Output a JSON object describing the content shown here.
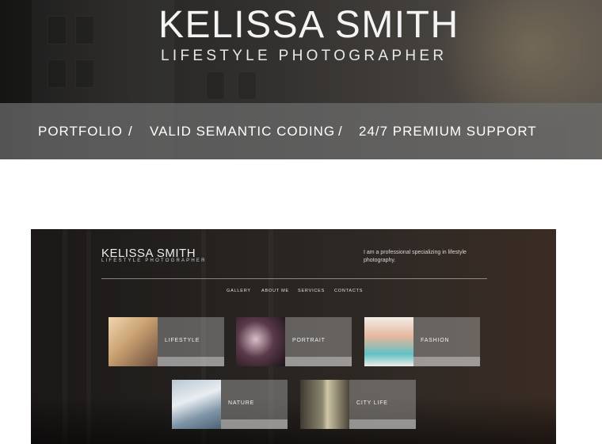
{
  "hero": {
    "title": "KELISSA SMITH",
    "subtitle": "LIFESTYLE PHOTOGRAPHER"
  },
  "nav": {
    "items": [
      "PORTFOLIO",
      "VALID SEMANTIC CODING",
      "24/7 PREMIUM SUPPORT"
    ],
    "separator": "/"
  },
  "preview": {
    "title": "KELISSA SMITH",
    "subtitle": "LIFESTYLE PHOTOGRAPHER",
    "description": "I am a professional specializing in lifestyle photography.",
    "menu": [
      "GALLERY",
      "ABOUT ME",
      "SERVICES",
      "CONTACTS"
    ],
    "cards": [
      "LIFESTYLE",
      "PORTRAIT",
      "FASHION",
      "NATURE",
      "CITY LIFE"
    ]
  },
  "colors": {
    "nav_band": "#6e6e6e",
    "text": "#ffffff",
    "page_bg": "#ffffff"
  }
}
